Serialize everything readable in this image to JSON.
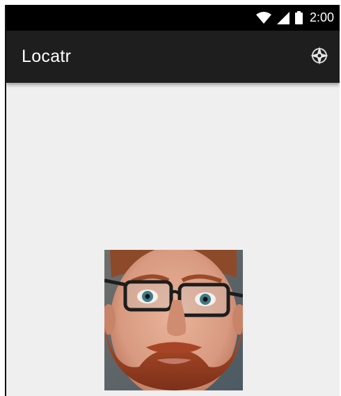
{
  "status_bar": {
    "time": "2:00",
    "icons": [
      "wifi-icon",
      "cellular-signal-icon",
      "battery-icon"
    ]
  },
  "app_bar": {
    "title": "Locatr",
    "action_icon": "locate-compass-icon"
  },
  "content": {
    "image": "portrait-photo"
  },
  "colors": {
    "status_bar": "#000000",
    "app_bar": "#1e1e1e",
    "background": "#efefef",
    "title_text": "#ffffff"
  }
}
